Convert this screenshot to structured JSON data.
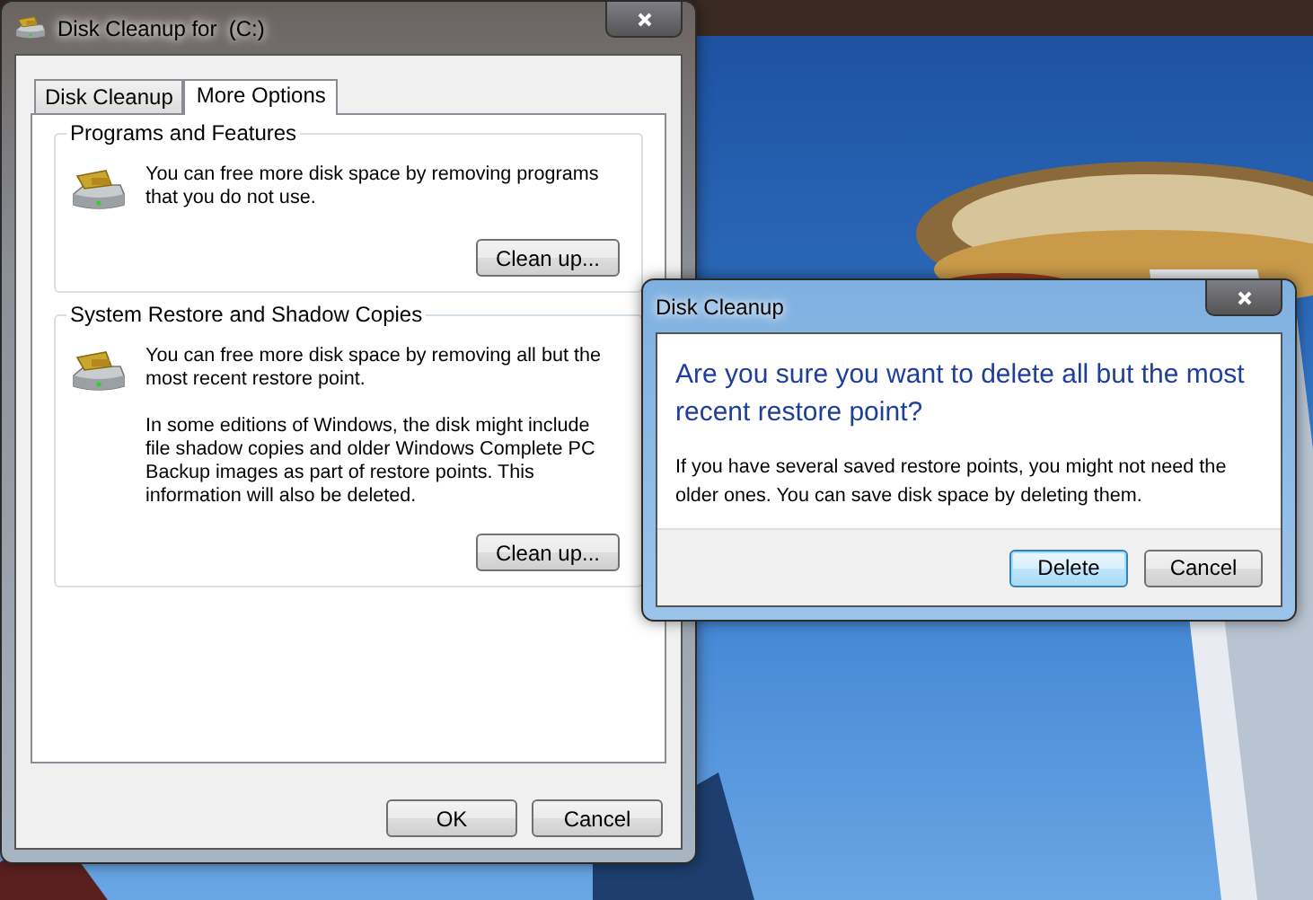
{
  "main_window": {
    "title": "Disk Cleanup for  (C:)",
    "tabs": [
      {
        "label": "Disk Cleanup",
        "selected": false
      },
      {
        "label": "More Options",
        "selected": true
      }
    ],
    "groups": [
      {
        "title": "Programs and Features",
        "paragraphs": [
          "You can free more disk space by removing programs that you do not use."
        ],
        "button": "Clean up..."
      },
      {
        "title": "System Restore and Shadow Copies",
        "paragraphs": [
          "You can free more disk space by removing all but the most recent restore point.",
          "In some editions of Windows, the disk might include file shadow copies and older Windows Complete PC Backup images as part of restore points. This information will also be deleted."
        ],
        "button": "Clean up..."
      }
    ],
    "buttons": [
      {
        "label": "OK",
        "default": false
      },
      {
        "label": "Cancel",
        "default": false
      }
    ]
  },
  "dialog": {
    "title": "Disk Cleanup",
    "heading": "Are you sure you want to delete all but the most recent restore point?",
    "message": "If you have several saved restore points, you might not need the older ones. You can save disk space by deleting them.",
    "buttons": [
      {
        "label": "Delete",
        "default": true
      },
      {
        "label": "Cancel",
        "default": false
      }
    ]
  }
}
